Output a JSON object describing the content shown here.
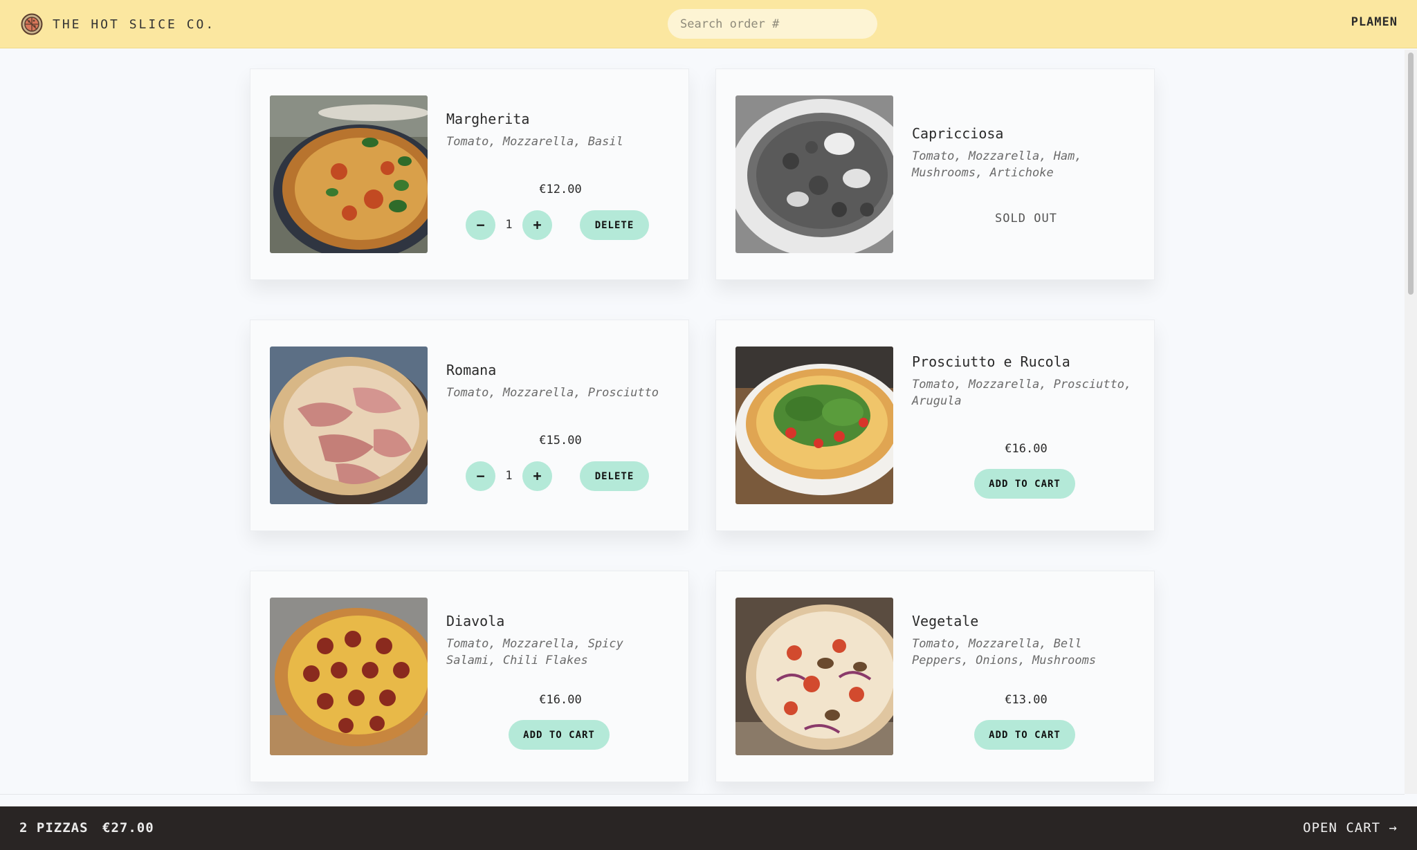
{
  "header": {
    "brand": "THE HOT SLICE CO.",
    "logo_icon": "pizza-logo-icon",
    "search_placeholder": "Search order #",
    "username": "PLAMEN"
  },
  "colors": {
    "header_bg": "#fbe7a0",
    "accent": "#b4e9d8",
    "footer_bg": "#292524",
    "page_bg": "#f7f9fc"
  },
  "menu": [
    {
      "name": "Margherita",
      "ingredients": "Tomato, Mozzarella, Basil",
      "price": "€12.00",
      "sold_out": false,
      "in_cart": true,
      "quantity": "1",
      "delete_label": "DELETE",
      "minus_label": "−",
      "plus_label": "+"
    },
    {
      "name": "Capricciosa",
      "ingredients": "Tomato, Mozzarella, Ham, Mushrooms, Artichoke",
      "sold_out": true,
      "sold_out_label": "SOLD OUT"
    },
    {
      "name": "Romana",
      "ingredients": "Tomato, Mozzarella, Prosciutto",
      "price": "€15.00",
      "sold_out": false,
      "in_cart": true,
      "quantity": "1",
      "delete_label": "DELETE",
      "minus_label": "−",
      "plus_label": "+"
    },
    {
      "name": "Prosciutto e Rucola",
      "ingredients": "Tomato, Mozzarella, Prosciutto, Arugula",
      "price": "€16.00",
      "sold_out": false,
      "in_cart": false,
      "add_label": "ADD TO CART"
    },
    {
      "name": "Diavola",
      "ingredients": "Tomato, Mozzarella, Spicy Salami, Chili Flakes",
      "price": "€16.00",
      "sold_out": false,
      "in_cart": false,
      "add_label": "ADD TO CART"
    },
    {
      "name": "Vegetale",
      "ingredients": "Tomato, Mozzarella, Bell Peppers, Onions, Mushrooms",
      "price": "€13.00",
      "sold_out": false,
      "in_cart": false,
      "add_label": "ADD TO CART"
    }
  ],
  "cart": {
    "count_label": "2 PIZZAS",
    "total": "€27.00",
    "open_label": "OPEN CART →"
  }
}
